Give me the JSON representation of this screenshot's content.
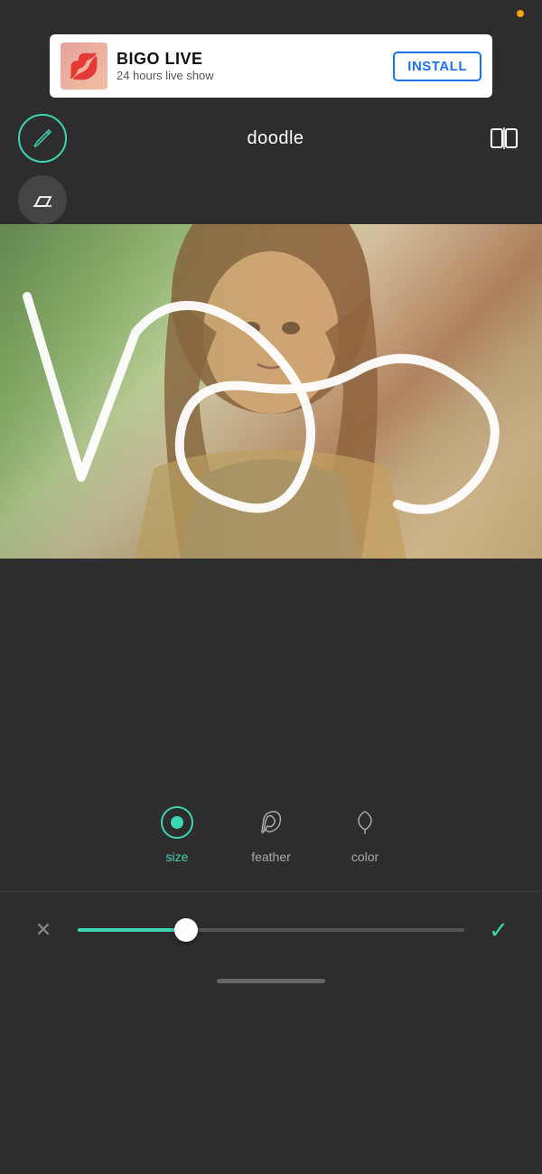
{
  "statusBar": {
    "dotColor": "#f0a500"
  },
  "ad": {
    "title": "BIGO LIVE",
    "subtitle": "24 hours live show",
    "installLabel": "INSTALL",
    "emoji": "💋"
  },
  "toolbar": {
    "title": "doodle",
    "brushIcon": "✏",
    "compareIcon": "⊞"
  },
  "brushOptions": [
    {
      "id": "size",
      "label": "size",
      "active": true
    },
    {
      "id": "feather",
      "label": "feather",
      "active": false
    },
    {
      "id": "color",
      "label": "color",
      "active": false
    }
  ],
  "slider": {
    "cancelIcon": "✕",
    "confirmIcon": "✓",
    "value": 30
  },
  "icons": {
    "brush": "🖊",
    "eraser": "◇",
    "compare": "[|]"
  }
}
